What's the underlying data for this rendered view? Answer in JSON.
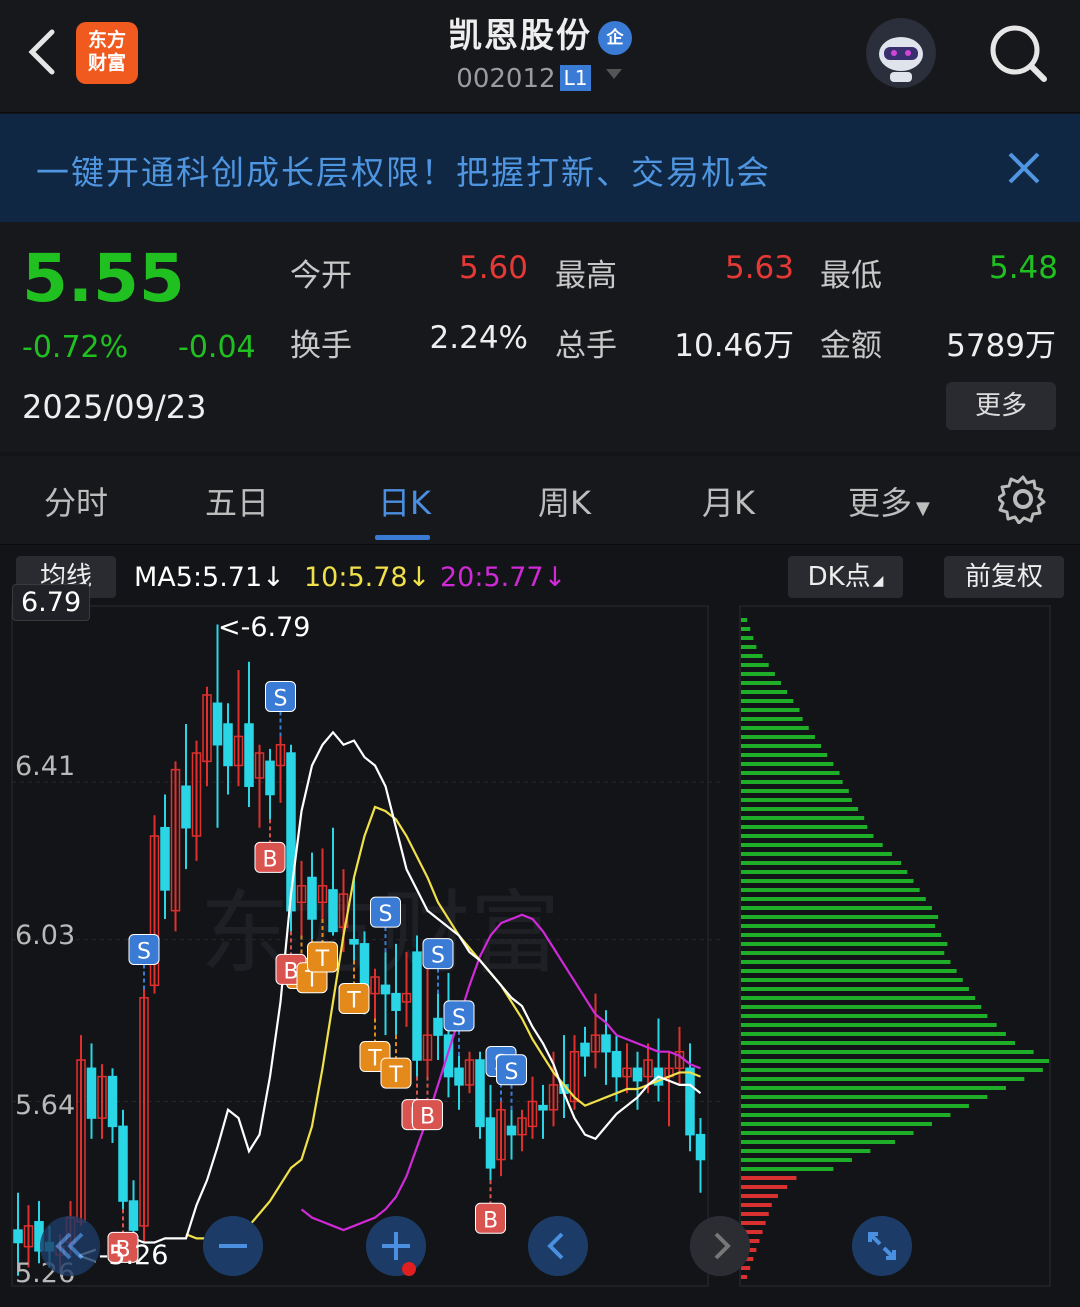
{
  "header": {
    "logo_line1": "东方",
    "logo_line2": "财富",
    "stock_name": "凯恩股份",
    "enterprise_badge": "企",
    "stock_code": "002012",
    "level_badge": "L1",
    "icons": [
      "back-icon",
      "robot-avatar",
      "search-icon"
    ]
  },
  "banner": {
    "text": "一键开通科创成长层权限！把握打新、交易机会"
  },
  "quote": {
    "price": "5.55",
    "change_pct": "-0.72%",
    "change_amt": "-0.04",
    "date": "2025/09/23",
    "open_label": "今开",
    "open_value": "5.60",
    "high_label": "最高",
    "high_value": "5.63",
    "low_label": "最低",
    "low_value": "5.48",
    "turnover_label": "换手",
    "turnover_value": "2.24%",
    "volume_label": "总手",
    "volume_value": "10.46万",
    "amount_label": "金额",
    "amount_value": "5789万",
    "more_label": "更多",
    "colors": {
      "up": "#e53935",
      "down": "#20c020"
    }
  },
  "tabs": {
    "items": [
      "分时",
      "五日",
      "日K",
      "周K",
      "月K",
      "更多"
    ],
    "active": "日K"
  },
  "chart_toolbar": {
    "ma_type_label": "均线",
    "ma5": "MA5:5.71↓",
    "ma10": "10:5.78↓",
    "ma20": "20:5.77↓",
    "dk_label": "DK点",
    "fuquan_label": "前复权",
    "colors": {
      "ma5": "#ffffff",
      "ma10": "#f0e04a",
      "ma20": "#d02ad8"
    }
  },
  "chart_data": {
    "type": "candlestick",
    "y_ticks": [
      "6.79",
      "6.41",
      "6.03",
      "5.64",
      "5.26"
    ],
    "ylim": [
      5.26,
      6.79
    ],
    "crosshair_label": "6.79",
    "high_marker": "<-6.79",
    "low_marker": "<-5.26",
    "watermark": "东方财富",
    "candles": [
      [
        5.33,
        5.3,
        5.42,
        5.22
      ],
      [
        5.29,
        5.34,
        5.39,
        5.24
      ],
      [
        5.35,
        5.28,
        5.4,
        5.25
      ],
      [
        5.3,
        5.28,
        5.34,
        5.24
      ],
      [
        5.27,
        5.29,
        5.32,
        5.23
      ],
      [
        5.3,
        5.36,
        5.4,
        5.27
      ],
      [
        5.35,
        5.74,
        5.8,
        5.34
      ],
      [
        5.72,
        5.6,
        5.78,
        5.55
      ],
      [
        5.6,
        5.7,
        5.73,
        5.55
      ],
      [
        5.7,
        5.58,
        5.72,
        5.54
      ],
      [
        5.58,
        5.4,
        5.62,
        5.38
      ],
      [
        5.4,
        5.33,
        5.45,
        5.3
      ],
      [
        5.34,
        5.89,
        5.91,
        5.3
      ],
      [
        5.92,
        6.28,
        6.33,
        5.9
      ],
      [
        6.3,
        6.15,
        6.38,
        6.08
      ],
      [
        6.1,
        6.44,
        6.46,
        6.05
      ],
      [
        6.4,
        6.3,
        6.55,
        6.2
      ],
      [
        6.28,
        6.48,
        6.51,
        6.22
      ],
      [
        6.46,
        6.62,
        6.64,
        6.4
      ],
      [
        6.6,
        6.5,
        6.79,
        6.3
      ],
      [
        6.55,
        6.45,
        6.6,
        6.38
      ],
      [
        6.45,
        6.52,
        6.68,
        6.4
      ],
      [
        6.55,
        6.4,
        6.7,
        6.35
      ],
      [
        6.42,
        6.48,
        6.5,
        6.3
      ],
      [
        6.46,
        6.38,
        6.49,
        6.32
      ],
      [
        6.45,
        6.5,
        6.52,
        6.36
      ],
      [
        6.48,
        6.1,
        6.5,
        6.05
      ],
      [
        6.12,
        6.16,
        6.22,
        6.04
      ],
      [
        6.18,
        6.08,
        6.24,
        6.03
      ],
      [
        6.12,
        6.16,
        6.25,
        6.08
      ],
      [
        6.15,
        6.05,
        6.3,
        6.04
      ],
      [
        6.06,
        6.14,
        6.2,
        6.0
      ],
      [
        6.03,
        6.02,
        6.18,
        5.98
      ],
      [
        6.02,
        5.9,
        6.05,
        5.85
      ],
      [
        5.9,
        5.94,
        5.96,
        5.84
      ],
      [
        5.92,
        5.9,
        6.0,
        5.8
      ],
      [
        5.9,
        5.86,
        6.02,
        5.8
      ],
      [
        5.88,
        5.9,
        6.0,
        5.82
      ],
      [
        6.0,
        5.74,
        6.04,
        5.7
      ],
      [
        5.74,
        5.8,
        6.02,
        5.7
      ],
      [
        5.84,
        5.8,
        5.9,
        5.74
      ],
      [
        5.8,
        5.7,
        5.95,
        5.65
      ],
      [
        5.72,
        5.68,
        5.75,
        5.62
      ],
      [
        5.68,
        5.74,
        5.76,
        5.66
      ],
      [
        5.74,
        5.58,
        5.76,
        5.55
      ],
      [
        5.6,
        5.48,
        5.68,
        5.45
      ],
      [
        5.5,
        5.62,
        5.64,
        5.46
      ],
      [
        5.58,
        5.56,
        5.62,
        5.5
      ],
      [
        5.56,
        5.6,
        5.62,
        5.52
      ],
      [
        5.58,
        5.64,
        5.7,
        5.55
      ],
      [
        5.63,
        5.62,
        5.68,
        5.55
      ],
      [
        5.62,
        5.68,
        5.76,
        5.58
      ],
      [
        5.68,
        5.66,
        5.8,
        5.6
      ],
      [
        5.64,
        5.76,
        5.8,
        5.62
      ],
      [
        5.78,
        5.75,
        5.82,
        5.7
      ],
      [
        5.76,
        5.8,
        5.9,
        5.72
      ],
      [
        5.8,
        5.76,
        5.86,
        5.68
      ],
      [
        5.76,
        5.7,
        5.8,
        5.64
      ],
      [
        5.7,
        5.72,
        5.78,
        5.66
      ],
      [
        5.72,
        5.69,
        5.76,
        5.62
      ],
      [
        5.7,
        5.74,
        5.78,
        5.66
      ],
      [
        5.72,
        5.68,
        5.84,
        5.64
      ],
      [
        5.7,
        5.72,
        5.76,
        5.58
      ],
      [
        5.72,
        5.76,
        5.82,
        5.68
      ],
      [
        5.72,
        5.56,
        5.78,
        5.52
      ],
      [
        5.56,
        5.5,
        5.6,
        5.42
      ]
    ],
    "ma5": [
      5.31,
      5.3,
      5.3,
      5.31,
      5.31,
      5.31,
      5.39,
      5.45,
      5.53,
      5.62,
      5.6,
      5.52,
      5.56,
      5.7,
      5.88,
      6.14,
      6.34,
      6.45,
      6.5,
      6.53,
      6.5,
      6.51,
      6.47,
      6.45,
      6.4,
      6.3,
      6.2,
      6.15,
      6.1,
      6.08,
      6.06,
      6.04,
      6.0,
      5.98,
      5.95,
      5.92,
      5.89,
      5.87,
      5.82,
      5.78,
      5.73,
      5.66,
      5.6,
      5.56,
      5.55,
      5.58,
      5.61,
      5.63,
      5.65,
      5.68,
      5.7,
      5.69,
      5.68,
      5.68,
      5.66
    ],
    "ma10": [
      5.32,
      5.31,
      5.31,
      5.31,
      5.31,
      5.31,
      5.34,
      5.37,
      5.4,
      5.44,
      5.48,
      5.5,
      5.58,
      5.72,
      5.88,
      6.04,
      6.18,
      6.28,
      6.35,
      6.34,
      6.32,
      6.28,
      6.23,
      6.18,
      6.12,
      6.08,
      6.04,
      6.01,
      5.98,
      5.95,
      5.92,
      5.88,
      5.84,
      5.79,
      5.75,
      5.71,
      5.68,
      5.65,
      5.63,
      5.64,
      5.65,
      5.66,
      5.67,
      5.67,
      5.68,
      5.69,
      5.7,
      5.71,
      5.71,
      5.7
    ],
    "ma20": [
      5.38,
      5.36,
      5.35,
      5.34,
      5.33,
      5.34,
      5.35,
      5.36,
      5.38,
      5.41,
      5.46,
      5.53,
      5.6,
      5.68,
      5.76,
      5.84,
      5.92,
      5.99,
      6.04,
      6.07,
      6.08,
      6.09,
      6.08,
      6.05,
      6.01,
      5.97,
      5.93,
      5.89,
      5.85,
      5.83,
      5.8,
      5.79,
      5.78,
      5.77,
      5.76,
      5.76,
      5.75,
      5.73,
      5.72
    ],
    "signals": [
      {
        "type": "S",
        "index": 12
      },
      {
        "type": "B",
        "index": 10
      },
      {
        "type": "S",
        "index": 25
      },
      {
        "type": "B",
        "index": 24
      },
      {
        "type": "T",
        "index": 27
      },
      {
        "type": "B",
        "index": 26
      },
      {
        "type": "T",
        "index": 28
      },
      {
        "type": "T",
        "index": 29
      },
      {
        "type": "S",
        "index": 35
      },
      {
        "type": "T",
        "index": 32
      },
      {
        "type": "T",
        "index": 34
      },
      {
        "type": "T",
        "index": 36
      },
      {
        "type": "S",
        "index": 40
      },
      {
        "type": "S",
        "index": 42
      },
      {
        "type": "B",
        "index": 38
      },
      {
        "type": "B",
        "index": 39
      },
      {
        "type": "S",
        "index": 46
      },
      {
        "type": "S",
        "index": 47
      },
      {
        "type": "B",
        "index": 45
      }
    ],
    "volume_profile_green": [
      0.02,
      0.03,
      0.04,
      0.05,
      0.07,
      0.09,
      0.11,
      0.13,
      0.15,
      0.17,
      0.19,
      0.2,
      0.22,
      0.24,
      0.26,
      0.28,
      0.3,
      0.32,
      0.33,
      0.35,
      0.36,
      0.38,
      0.4,
      0.41,
      0.43,
      0.46,
      0.49,
      0.52,
      0.54,
      0.56,
      0.58,
      0.6,
      0.62,
      0.64,
      0.63,
      0.65,
      0.67,
      0.66,
      0.68,
      0.7,
      0.72,
      0.74,
      0.76,
      0.78,
      0.8,
      0.83,
      0.86,
      0.89,
      0.95,
      1.0,
      0.98,
      0.92,
      0.86,
      0.8,
      0.74,
      0.68,
      0.62,
      0.56,
      0.5,
      0.42,
      0.36,
      0.3
    ],
    "volume_profile_red": [
      0.18,
      0.15,
      0.12,
      0.1,
      0.09,
      0.08,
      0.07,
      0.06,
      0.05,
      0.04,
      0.03,
      0.02
    ]
  },
  "controls": {
    "icons": [
      "double-left-icon",
      "zoom-out-icon",
      "zoom-in-icon",
      "prev-icon",
      "next-icon",
      "fullscreen-icon"
    ]
  }
}
